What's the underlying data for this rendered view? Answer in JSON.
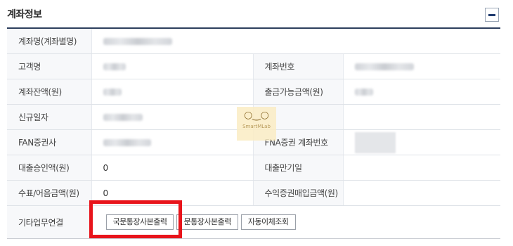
{
  "section": {
    "title": "계좌정보"
  },
  "rows": [
    {
      "label": "계좌명(계좌별명)",
      "value": ""
    },
    {
      "label": "고객명",
      "value": "",
      "label2": "계좌번호",
      "value2": ""
    },
    {
      "label": "계좌잔액(원)",
      "value": "",
      "label2": "출금가능금액(원)",
      "value2": ""
    },
    {
      "label": "신규일자",
      "value": "",
      "label2": "",
      "value2": ""
    },
    {
      "label": "FAN증권사",
      "value": "",
      "label2": "FNA증권 계좌번호",
      "value2": ""
    },
    {
      "label": "대출승인액(원)",
      "value": "0",
      "label2": "대출만기일",
      "value2": ""
    },
    {
      "label": "수표/어음금액(원)",
      "value": "0",
      "label2": "수익증권매입금액(원)",
      "value2": ""
    },
    {
      "label": "기타업무연결"
    }
  ],
  "buttons": [
    {
      "label": "국문통장사본출력"
    },
    {
      "label": "문통장사본출력"
    },
    {
      "label": "자동이체조회"
    }
  ],
  "watermark": {
    "text": "SmartMLab"
  },
  "colors": {
    "highlight": "#e8141b",
    "header_rule": "#2d3f5e",
    "collapse_icon": "#1e3a6e"
  }
}
